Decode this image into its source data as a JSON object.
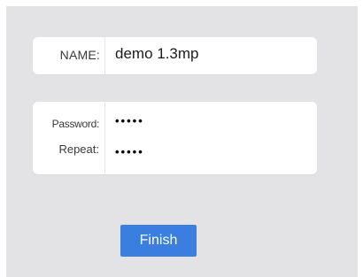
{
  "form": {
    "name_label": "NAME:",
    "name_value": "demo 1.3mp",
    "password_label": "Password:",
    "password_value": "•••••",
    "repeat_label": "Repeat:",
    "repeat_value": "•••••"
  },
  "actions": {
    "finish_label": "Finish"
  },
  "colors": {
    "background": "#e3e3e5",
    "accent": "#3a7ee0"
  }
}
